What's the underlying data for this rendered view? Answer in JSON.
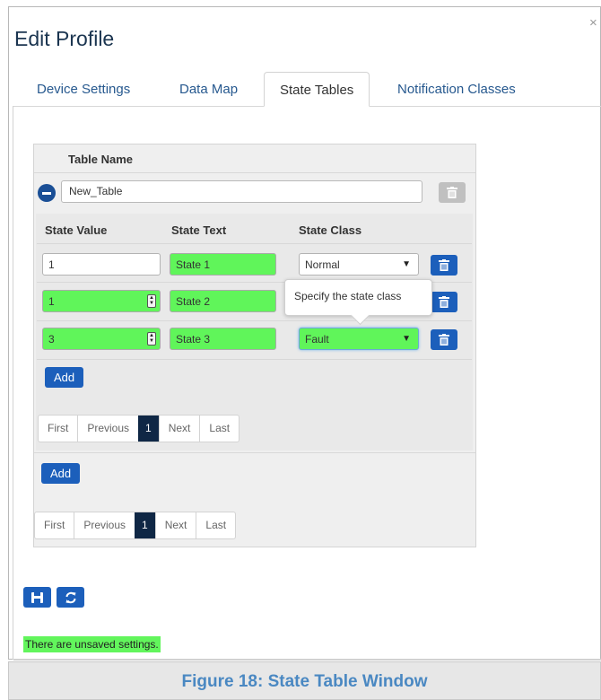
{
  "dialog": {
    "title": "Edit Profile",
    "close_glyph": "×"
  },
  "tabs": [
    {
      "label": "Device Settings",
      "active": false
    },
    {
      "label": "Data Map",
      "active": false
    },
    {
      "label": "State Tables",
      "active": true
    },
    {
      "label": "Notification Classes",
      "active": false
    }
  ],
  "table": {
    "name_header": "Table Name",
    "name_value": "New_Table",
    "columns": [
      "State Value",
      "State Text",
      "State Class"
    ],
    "rows": [
      {
        "value": "1",
        "text": "State 1",
        "class": "Normal"
      },
      {
        "value": "1",
        "text": "State 2",
        "class": ""
      },
      {
        "value": "3",
        "text": "State 3",
        "class": "Fault"
      }
    ],
    "tooltip": "Specify the state class",
    "add_label": "Add",
    "pager": [
      "First",
      "Previous",
      "1",
      "Next",
      "Last"
    ]
  },
  "outer": {
    "add_label": "Add",
    "pager": [
      "First",
      "Previous",
      "1",
      "Next",
      "Last"
    ]
  },
  "footer": {
    "status": "There are unsaved settings."
  },
  "caption": "Figure 18: State Table Window",
  "colors": {
    "accent": "#1c5fbb",
    "highlight_green": "#60f55a",
    "caption_text": "#4a88c2"
  }
}
